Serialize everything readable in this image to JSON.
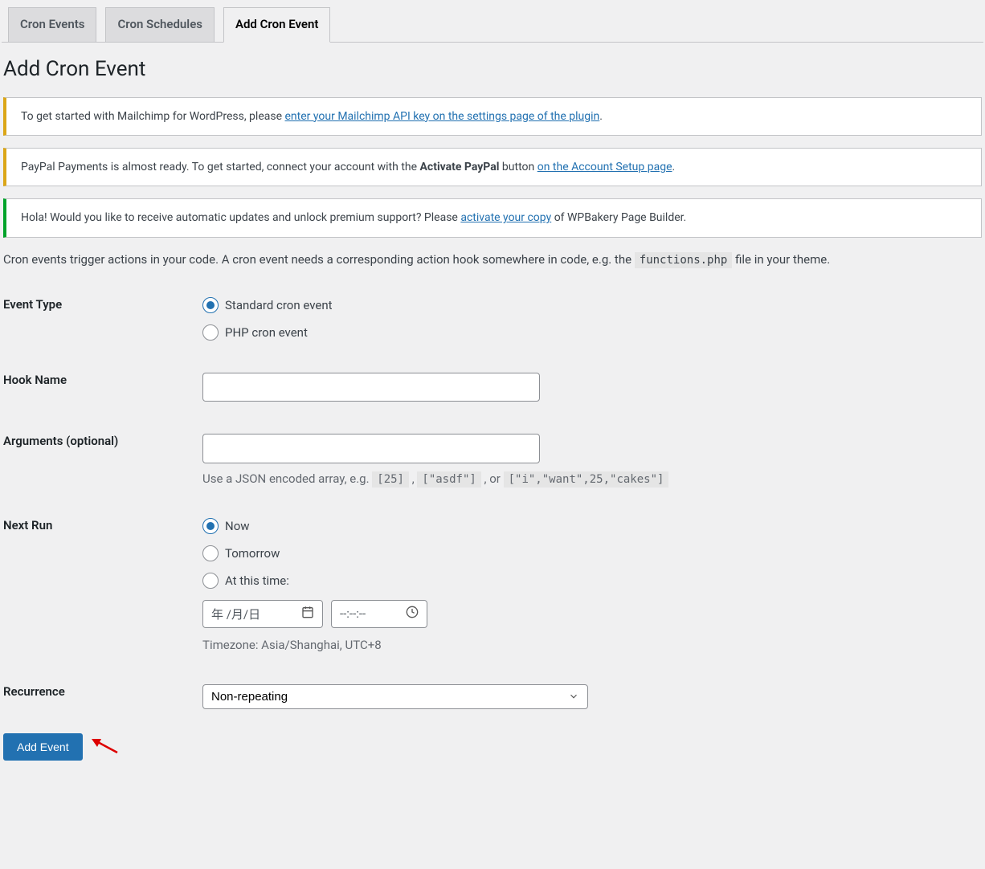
{
  "tabs": [
    {
      "label": "Cron Events",
      "active": false
    },
    {
      "label": "Cron Schedules",
      "active": false
    },
    {
      "label": "Add Cron Event",
      "active": true
    }
  ],
  "page_title": "Add Cron Event",
  "notices": {
    "mailchimp_pre": "To get started with Mailchimp for WordPress, please ",
    "mailchimp_link": "enter your Mailchimp API key on the settings page of the plugin",
    "mailchimp_post": ".",
    "paypal_pre": "PayPal Payments is almost ready. To get started, connect your account with the ",
    "paypal_strong": "Activate PayPal",
    "paypal_mid": " button ",
    "paypal_link": "on the Account Setup page",
    "paypal_post": ".",
    "wpbakery_pre": "Hola! Would you like to receive automatic updates and unlock premium support? Please ",
    "wpbakery_link": "activate your copy",
    "wpbakery_post": " of WPBakery Page Builder."
  },
  "intro": {
    "pre": "Cron events trigger actions in your code. A cron event needs a corresponding action hook somewhere in code, e.g. the ",
    "code": "functions.php",
    "post": " file in your theme."
  },
  "form": {
    "event_type": {
      "label": "Event Type",
      "options": [
        {
          "label": "Standard cron event",
          "checked": true
        },
        {
          "label": "PHP cron event",
          "checked": false
        }
      ]
    },
    "hook_name": {
      "label": "Hook Name",
      "value": ""
    },
    "arguments": {
      "label": "Arguments (optional)",
      "value": "",
      "desc_pre": "Use a JSON encoded array, e.g. ",
      "code1": "[25]",
      "sep1": " , ",
      "code2": "[\"asdf\"]",
      "sep2": " , or ",
      "code3": "[\"i\",\"want\",25,\"cakes\"]"
    },
    "next_run": {
      "label": "Next Run",
      "options": [
        {
          "label": "Now",
          "checked": true
        },
        {
          "label": "Tomorrow",
          "checked": false
        },
        {
          "label": "At this time:",
          "checked": false
        }
      ],
      "date_placeholder": "年 /月/日",
      "time_placeholder": "--:--:--",
      "timezone": "Timezone: Asia/Shanghai, UTC+8"
    },
    "recurrence": {
      "label": "Recurrence",
      "selected": "Non-repeating"
    },
    "submit_label": "Add Event"
  }
}
